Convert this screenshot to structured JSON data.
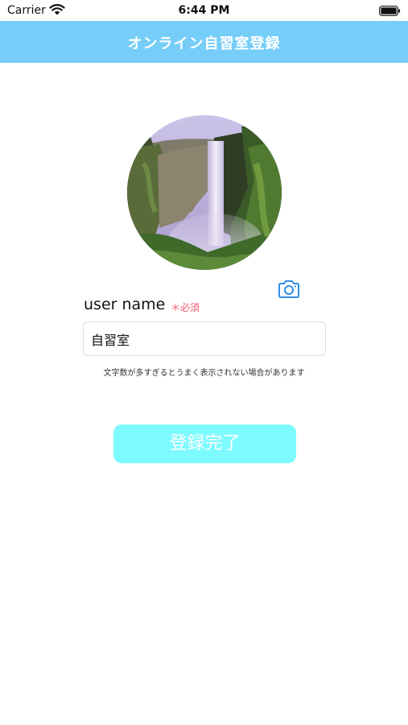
{
  "status_bar": {
    "carrier": "Carrier",
    "time": "6:44 PM",
    "wifi_icon": "wifi-icon",
    "battery_icon": "battery-icon"
  },
  "nav": {
    "title": "オンライン自習室登録",
    "background": "#75cdf8"
  },
  "profile": {
    "avatar": "waterfall-photo",
    "camera_icon": "camera-icon",
    "accent_color": "#2f8ee6"
  },
  "form": {
    "username_label": "user name",
    "required_label": "＊必須",
    "required_color": "#ef5a6e",
    "username_value": "自習室",
    "hint": "文字数が多すぎるとうまく表示されない場合があります"
  },
  "submit": {
    "label": "登録完了",
    "background": "#7dfbff"
  }
}
